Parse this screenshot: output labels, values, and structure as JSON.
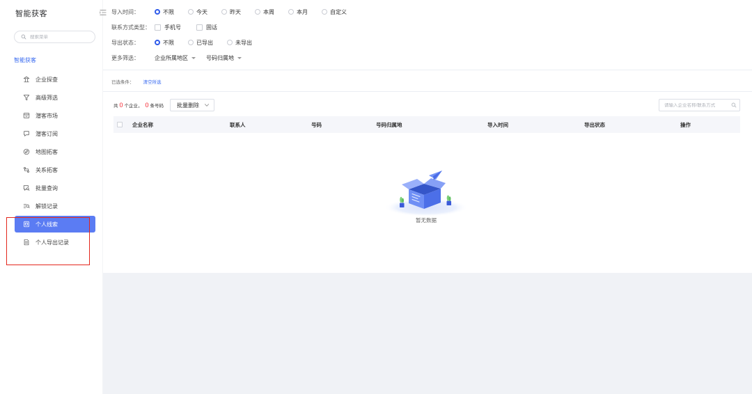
{
  "colors": {
    "accent": "#5b7cf3",
    "link": "#3b6cf0",
    "radio_selected": "#2f5bea",
    "count": "#f5222d",
    "annotation": "#e3261c"
  },
  "sidebar": {
    "title": "智能获客",
    "collapse_icon": "menu-fold-icon",
    "search": {
      "placeholder": "搜索菜单",
      "value": "",
      "icon": "search-icon"
    },
    "section_label": "智能获客",
    "items": [
      {
        "label": "企业探查",
        "icon": "building-icon",
        "active": false
      },
      {
        "label": "高级筛选",
        "icon": "filter-icon",
        "active": false
      },
      {
        "label": "潜客市场",
        "icon": "market-icon",
        "active": false
      },
      {
        "label": "潜客订阅",
        "icon": "subscribe-icon",
        "active": false
      },
      {
        "label": "地图拓客",
        "icon": "map-icon",
        "active": false
      },
      {
        "label": "关系拓客",
        "icon": "relation-icon",
        "active": false
      },
      {
        "label": "批量查询",
        "icon": "batch-search-icon",
        "active": false
      },
      {
        "label": "解锁记录",
        "icon": "unlock-record-icon",
        "active": false
      },
      {
        "label": "个人线索",
        "icon": "lead-icon",
        "active": true
      },
      {
        "label": "个人导出记录",
        "icon": "export-record-icon",
        "active": false
      }
    ]
  },
  "filters": {
    "import_time": {
      "label": "导入时间：",
      "options": [
        {
          "label": "不限",
          "selected": true
        },
        {
          "label": "今天",
          "selected": false
        },
        {
          "label": "昨天",
          "selected": false
        },
        {
          "label": "本周",
          "selected": false
        },
        {
          "label": "本月",
          "selected": false
        },
        {
          "label": "自定义",
          "selected": false
        }
      ]
    },
    "contact_type": {
      "label": "联系方式类型：",
      "options": [
        {
          "label": "手机号",
          "checked": false
        },
        {
          "label": "固话",
          "checked": false
        }
      ]
    },
    "export_status": {
      "label": "导出状态：",
      "options": [
        {
          "label": "不限",
          "selected": true
        },
        {
          "label": "已导出",
          "selected": false
        },
        {
          "label": "未导出",
          "selected": false
        }
      ]
    },
    "more": {
      "label": "更多筛选：",
      "dropdowns": [
        {
          "label": "企业所属地区"
        },
        {
          "label": "号码归属地"
        }
      ]
    }
  },
  "selected_conditions": {
    "label": "已选条件：",
    "clear_label": "清空所选"
  },
  "summary": {
    "prefix": "共",
    "company_count": 0,
    "company_suffix": "个企业，",
    "phone_count": 0,
    "phone_suffix": "条号码"
  },
  "toolbar": {
    "batch_delete_label": "批量删除",
    "search": {
      "placeholder": "请输入企业名称/联系方式",
      "value": "",
      "icon": "search-icon"
    }
  },
  "table": {
    "columns": [
      "企业名称",
      "联系人",
      "号码",
      "号码归属地",
      "导入时间",
      "导出状态",
      "操作"
    ],
    "rows": []
  },
  "empty_state": {
    "text": "暂无数据"
  }
}
